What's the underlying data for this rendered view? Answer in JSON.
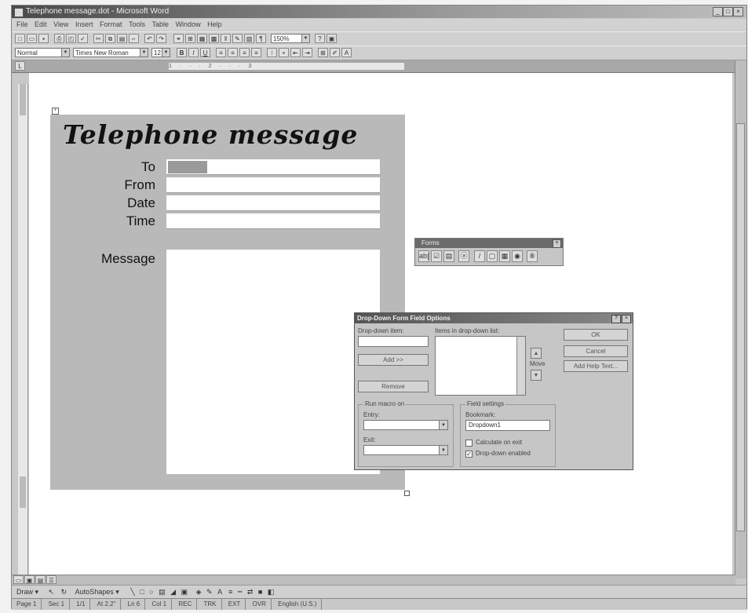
{
  "window": {
    "title": "Telephone message.dot - Microsoft Word",
    "controls": [
      "_",
      "□",
      "×"
    ]
  },
  "menu": {
    "items": [
      "File",
      "Edit",
      "View",
      "Insert",
      "Format",
      "Tools",
      "Table",
      "Window",
      "Help"
    ]
  },
  "toolbar": {
    "zoom": "150%",
    "style": "Normal",
    "font": "Times New Roman",
    "font_size": "12",
    "bold": "B",
    "italic": "I",
    "underline": "U"
  },
  "ruler": {
    "marks": "1 · · · 2 · · · 3"
  },
  "form": {
    "title": "Telephone message",
    "to_label": "To",
    "from_label": "From",
    "date_label": "Date",
    "time_label": "Time",
    "message_label": "Message"
  },
  "forms_toolbar": {
    "title": "Forms",
    "close": "×",
    "buttons": [
      "ab|",
      "☑",
      "▤",
      "ⓐ",
      "/",
      "▢",
      "▦",
      "◉",
      "⑧"
    ]
  },
  "dialog": {
    "title": "Drop-Down Form Field Options",
    "help": "?",
    "close": "×",
    "dropdown_item_label": "Drop-down item:",
    "items_label": "Items in drop-down list:",
    "add_button": "Add >>",
    "remove_button": "Remove",
    "move_label": "Move",
    "ok_button": "OK",
    "cancel_button": "Cancel",
    "help_text_button": "Add Help Text...",
    "run_macro_label": "Run macro on",
    "entry_label": "Entry:",
    "exit_label": "Exit:",
    "field_settings_label": "Field settings",
    "bookmark_label": "Bookmark:",
    "bookmark_value": "Dropdown1",
    "calculate_label": "Calculate on exit",
    "enabled_label": "Drop-down enabled",
    "enabled_checked": "✓"
  },
  "drawing": {
    "draw_label": "Draw ▾",
    "autoshapes_label": "AutoShapes ▾"
  },
  "status": {
    "page": "Page 1",
    "sec": "Sec 1",
    "pages": "1/1",
    "at": "At 2.2\"",
    "ln": "Ln 6",
    "col": "Col 1",
    "rec": "REC",
    "trk": "TRK",
    "ext": "EXT",
    "ovr": "OVR",
    "lang": "English (U.S.)"
  }
}
